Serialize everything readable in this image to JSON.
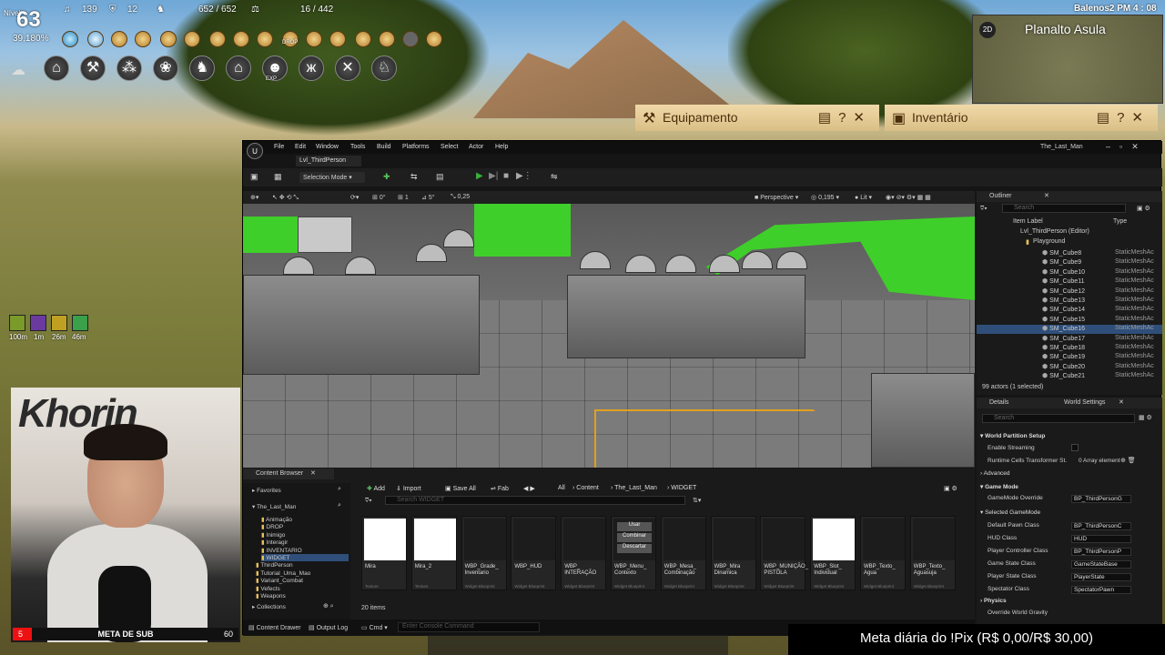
{
  "hud": {
    "level_label": "Nível",
    "level": "63",
    "level_pct": "39,180%",
    "stat1": "139",
    "stat2": "12",
    "hp": "652 / 652",
    "weight": "16 / 442",
    "buff_label_drop": "DROP",
    "buff_label_exp": "EXP",
    "skill_timers": [
      "100m",
      "1m",
      "26m",
      "46m"
    ],
    "player_name": "Balenos2",
    "time": "PM 4 : 08",
    "minimap_label": "Planalto Asula",
    "minimap_mode": "2D",
    "panel_equip": "Equipamento",
    "panel_inventory": "Inventário"
  },
  "webcam": {
    "sign_text": "Khorin",
    "sub_label": "META DE SUB",
    "sub_current": "5",
    "sub_max": "60",
    "sub_progress": 0.083
  },
  "banner": {
    "text": "Meta diária do !Pix (R$ 0,00/R$ 30,00)"
  },
  "editor": {
    "menu": [
      "File",
      "Edit",
      "Window",
      "Tools",
      "Build",
      "Platforms",
      "Select",
      "Actor",
      "Help"
    ],
    "app_title": "The_Last_Man",
    "level_tab": "Lvl_ThirdPerson",
    "selection_mode": "Selection Mode",
    "viewport": {
      "perspective": "Perspective",
      "lit": "Lit",
      "speed": "0,195",
      "snap_rot": "0°",
      "snap_grid": "1",
      "snap_angle": "5°",
      "snap_scale": "0,25"
    },
    "outliner": {
      "title": "Outliner",
      "search": "Search",
      "col_label": "Item Label",
      "col_type": "Type",
      "root": "Lvl_ThirdPerson (Editor)",
      "folder": "Playground",
      "items": [
        "SM_Cube8",
        "SM_Cube9",
        "SM_Cube10",
        "SM_Cube11",
        "SM_Cube12",
        "SM_Cube13",
        "SM_Cube14",
        "SM_Cube15",
        "SM_Cube16",
        "SM_Cube17",
        "SM_Cube18",
        "SM_Cube19",
        "SM_Cube20",
        "SM_Cube21"
      ],
      "item_type": "StaticMeshAc",
      "selected_index": 8,
      "count": "99 actors (1 selected)"
    },
    "details": {
      "tab_details": "Details",
      "tab_world": "World Settings",
      "search": "Search",
      "sections": {
        "world_partition": "World Partition Setup",
        "advanced": "Advanced",
        "game_mode": "Game Mode",
        "selected_gamemode": "Selected GameMode",
        "physics": "Physics"
      },
      "enable_streaming": "Enable Streaming",
      "runtime_cells": "Runtime Cells Transformer St.",
      "runtime_cells_val": "0 Array element",
      "rows": [
        {
          "k": "GameMode Override",
          "v": "BP_ThirdPersonG"
        },
        {
          "k": "Default Pawn Class",
          "v": "BP_ThirdPersonC"
        },
        {
          "k": "HUD Class",
          "v": "HUD"
        },
        {
          "k": "Player Controller Class",
          "v": "BP_ThirdPersonP"
        },
        {
          "k": "Game State Class",
          "v": "GameStateBase"
        },
        {
          "k": "Player State Class",
          "v": "PlayerState"
        },
        {
          "k": "Spectator Class",
          "v": "SpectatorPawn"
        }
      ],
      "override_gravity": "Override World Gravity"
    },
    "content_browser": {
      "title": "Content Browser",
      "favorites": "Favorites",
      "project": "The_Last_Man",
      "tree": [
        "Animação",
        "DROP",
        "Inimigo",
        "Interagir",
        "INVENTARIO",
        "WIDGET",
        "ThirdPerson",
        "Tutorial_Uma_Mao",
        "Variant_Combat",
        "Vefects",
        "Weapons"
      ],
      "selected_tree": "WIDGET",
      "collections": "Collections",
      "add": "Add",
      "import": "Import",
      "save_all": "Save All",
      "fab": "Fab",
      "path": [
        "All",
        "Content",
        "The_Last_Man",
        "WIDGET"
      ],
      "search_placeholder": "Search WIDGET",
      "assets": [
        {
          "name": "Mira",
          "cls": "Texture",
          "white": true
        },
        {
          "name": "Mira_2",
          "cls": "Texture",
          "white": true
        },
        {
          "name": "WBP_Grade_ Inventario",
          "cls": "Widget Blueprint"
        },
        {
          "name": "WBP_HUD",
          "cls": "Widget Blueprint"
        },
        {
          "name": "WBP_ INTERAÇÃO",
          "cls": "Widget Blueprint"
        },
        {
          "name": "WBP_Menu_ Contexto",
          "cls": "Widget Blueprint",
          "menu": [
            "Usar",
            "Combinar",
            "Descartar"
          ]
        },
        {
          "name": "WBP_Mesa_ Combinação",
          "cls": "Widget Blueprint"
        },
        {
          "name": "WBP_Mira Dinamica",
          "cls": "Widget Blueprint"
        },
        {
          "name": "WBP_MUNIÇÃO_ PISTOLA",
          "cls": "Widget Blueprint"
        },
        {
          "name": "WBP_Slot_ Individual",
          "cls": "Widget Blueprint",
          "white": true
        },
        {
          "name": "WBP_Texto_ Agua",
          "cls": "Widget Blueprint"
        },
        {
          "name": "WBP_Texto_ Aguasuja",
          "cls": "Widget Blueprint"
        }
      ],
      "item_count": "20 items",
      "content_drawer": "Content Drawer",
      "output_log": "Output Log",
      "cmd": "Cmd",
      "console_placeholder": "Enter Console Command"
    }
  }
}
